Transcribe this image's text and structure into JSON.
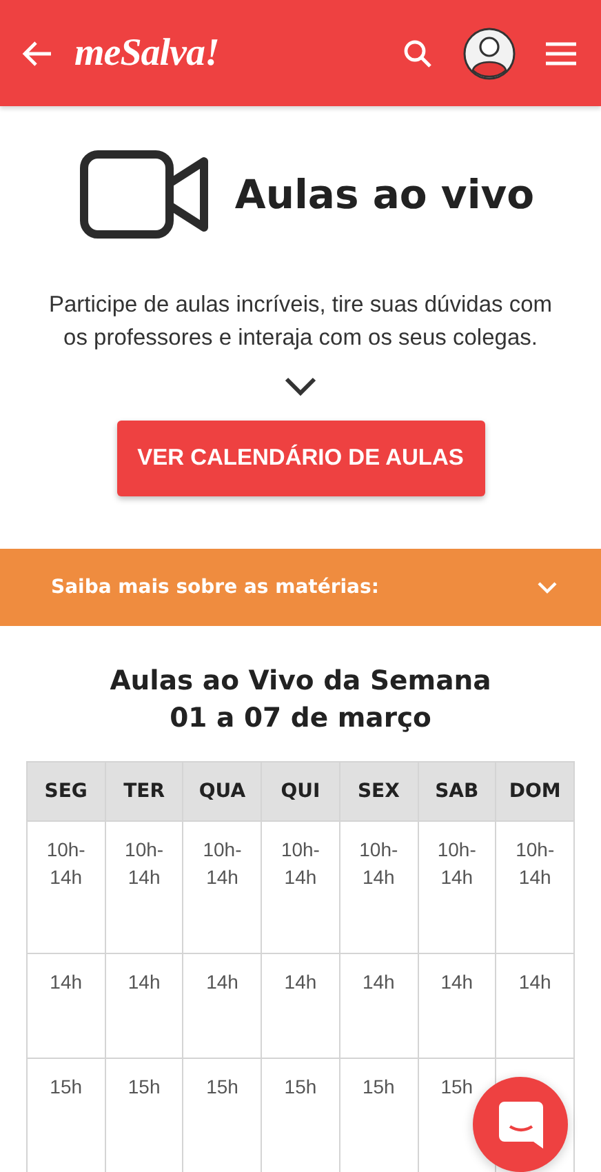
{
  "header": {
    "logo": "meSalva!"
  },
  "hero": {
    "title": "Aulas ao vivo",
    "description": "Participe de aulas incríveis, tire suas dúvidas com os professores e interaja com os seus colegas.",
    "button": "VER CALENDÁRIO DE AULAS"
  },
  "accordion": {
    "label": "Saiba mais sobre as matérias:",
    "expanded": false
  },
  "schedule": {
    "title": "Aulas ao Vivo da Semana",
    "subtitle": "01 a 07 de março",
    "columns": [
      "SEG",
      "TER",
      "QUA",
      "QUI",
      "SEX",
      "SAB",
      "DOM"
    ],
    "rows": [
      [
        "10h-\n14h",
        "10h-\n14h",
        "10h-\n14h",
        "10h-\n14h",
        "10h-\n14h",
        "10h-\n14h",
        "10h-\n14h"
      ],
      [
        "14h",
        "14h",
        "14h",
        "14h",
        "14h",
        "14h",
        "14h"
      ],
      [
        "15h",
        "15h",
        "15h",
        "15h",
        "15h",
        "15h"
      ]
    ]
  }
}
